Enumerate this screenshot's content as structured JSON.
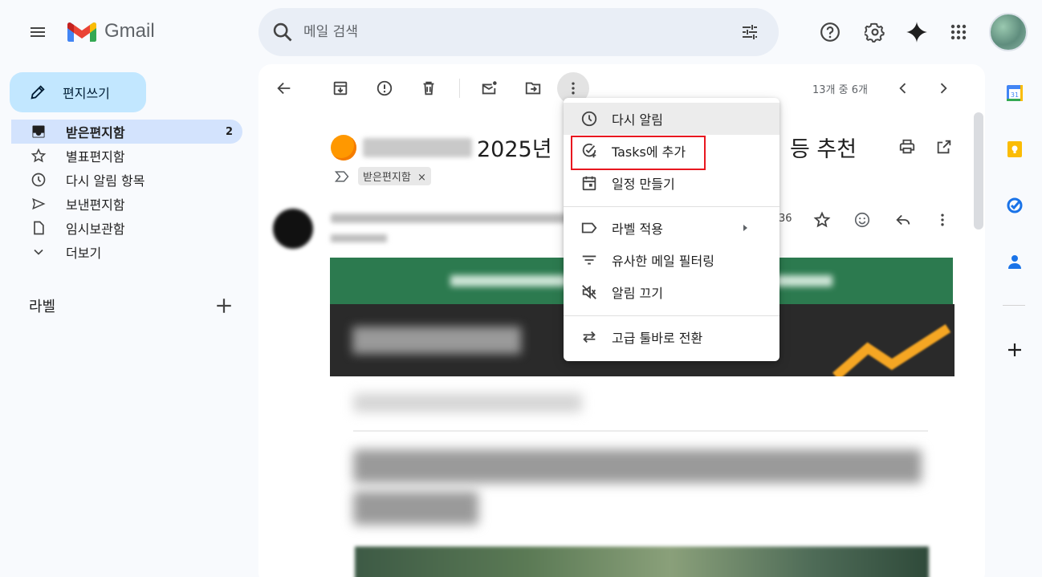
{
  "header": {
    "app_name": "Gmail",
    "search_placeholder": "메일 검색"
  },
  "nav": {
    "compose_label": "편지쓰기",
    "items": [
      {
        "label": "받은편지함",
        "count": "2",
        "icon": "inbox-icon",
        "active": true
      },
      {
        "label": "별표편지함",
        "icon": "star-icon"
      },
      {
        "label": "다시 알림 항목",
        "icon": "clock-icon"
      },
      {
        "label": "보낸편지함",
        "icon": "send-icon"
      },
      {
        "label": "임시보관함",
        "icon": "draft-icon"
      },
      {
        "label": "더보기",
        "icon": "chevron-down-icon"
      }
    ],
    "labels_title": "라벨"
  },
  "toolbar": {
    "pager": "13개 중 6개"
  },
  "email": {
    "subject_visible_start": "2025년",
    "subject_visible_end": "등 추천",
    "tag": "받은편지함",
    "tag_close": "×",
    "time_fragment": "36"
  },
  "menu": {
    "items": [
      {
        "label": "다시 알림",
        "icon": "clock-icon"
      },
      {
        "label": "Tasks에 추가",
        "icon": "add-task-icon"
      },
      {
        "label": "일정 만들기",
        "icon": "calendar-event-icon"
      },
      {
        "label": "라벨 적용",
        "icon": "label-icon"
      },
      {
        "label": "유사한 메일 필터링",
        "icon": "filter-icon"
      },
      {
        "label": "알림 끄기",
        "icon": "mute-icon"
      },
      {
        "label": "고급 툴바로 전환",
        "icon": "swap-icon"
      }
    ]
  },
  "side_panel": {
    "calendar_day": "31"
  },
  "colors": {
    "compose_bg": "#c2e7ff",
    "active_nav_bg": "#d3e3fd",
    "highlight_box": "#e8171f",
    "banner_green": "#2c7a4f"
  }
}
